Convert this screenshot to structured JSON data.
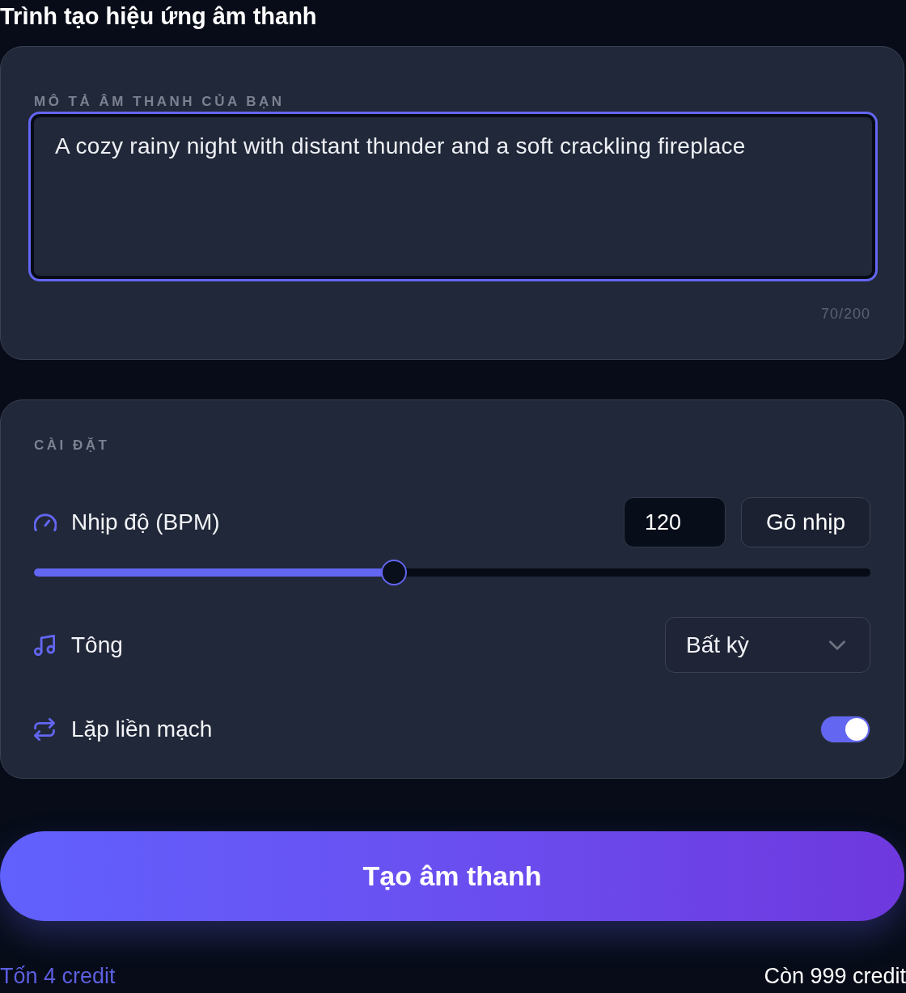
{
  "title": "Trình tạo hiệu ứng âm thanh",
  "description": {
    "label": "MÔ TẢ ÂM THANH CỦA BẠN",
    "value": "A cozy rainy night with distant thunder and a soft crackling fireplace",
    "focused": true,
    "counter": "70/200"
  },
  "settings": {
    "heading": "CÀI ĐẶT",
    "rows": [
      {
        "kind": "tempo",
        "label": "Nhịp độ (BPM)",
        "value": "120",
        "button": "Gō nhịp",
        "level": 0.43
      },
      {
        "kind": "select",
        "label": "Tông",
        "value": "Bất kỳ"
      },
      {
        "kind": "toggle",
        "label": "Lặp liền mạch",
        "on": true
      }
    ]
  },
  "generate_button": {
    "label": "Tạo âm thanh"
  },
  "footer": {
    "cost": "Tốn 4 credit",
    "balance": "Còn 999 credit"
  }
}
